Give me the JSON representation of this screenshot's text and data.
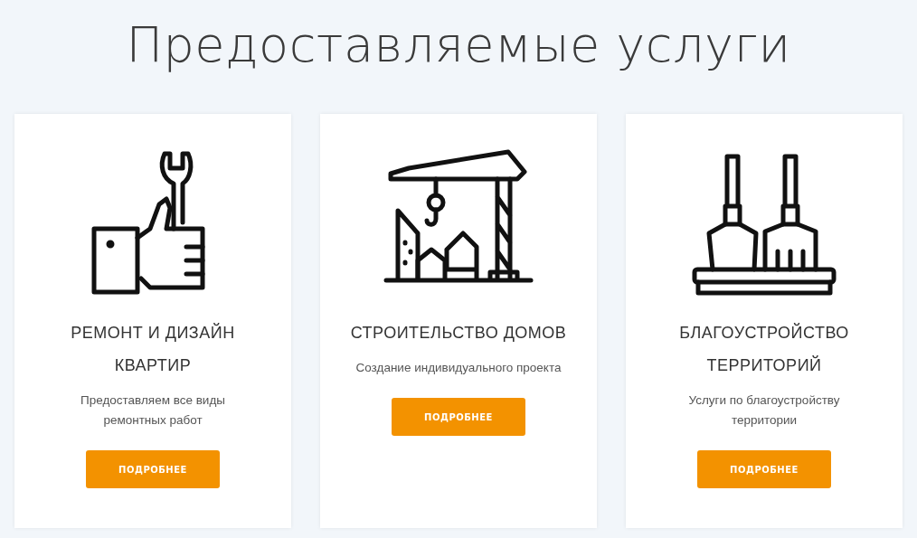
{
  "heading": "Предоставляемые услуги",
  "services": [
    {
      "kind": "repair",
      "title": "РЕМОНТ И ДИЗАЙН КВАРТИР",
      "description": "Предоставляем все виды ремонтных работ",
      "button": "ПОДРОБНЕЕ"
    },
    {
      "kind": "construction",
      "title": "СТРОИТЕЛЬСТВО ДОМОВ",
      "description": "Создание индивидуального проекта",
      "button": "ПОДРОБНЕЕ"
    },
    {
      "kind": "landscaping",
      "title": "БЛАГОУСТРОЙСТВО ТЕРРИТОРИЙ",
      "description": "Услуги по благоустройству территории",
      "button": "ПОДРОБНЕЕ"
    }
  ]
}
